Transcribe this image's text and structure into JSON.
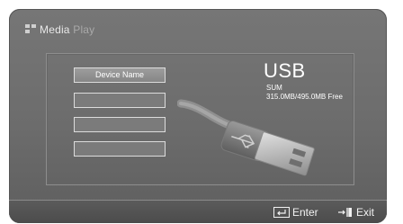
{
  "header": {
    "title_main": "Media",
    "title_sub": "Play"
  },
  "device_list": {
    "items": [
      {
        "label": "Device Name",
        "selected": true
      },
      {
        "label": "",
        "selected": false
      },
      {
        "label": "",
        "selected": false
      },
      {
        "label": "",
        "selected": false
      }
    ]
  },
  "device_info": {
    "type": "USB",
    "label": "SUM",
    "space": "315.0MB/495.0MB Free",
    "icon": "usb-connector-icon"
  },
  "footer": {
    "enter_label": "Enter",
    "exit_label": "Exit",
    "enter_icon": "enter-icon",
    "exit_icon": "exit-icon"
  },
  "colors": {
    "background": "#6c6c6c",
    "text": "#ffffff",
    "footer": "#4b4b4b"
  }
}
